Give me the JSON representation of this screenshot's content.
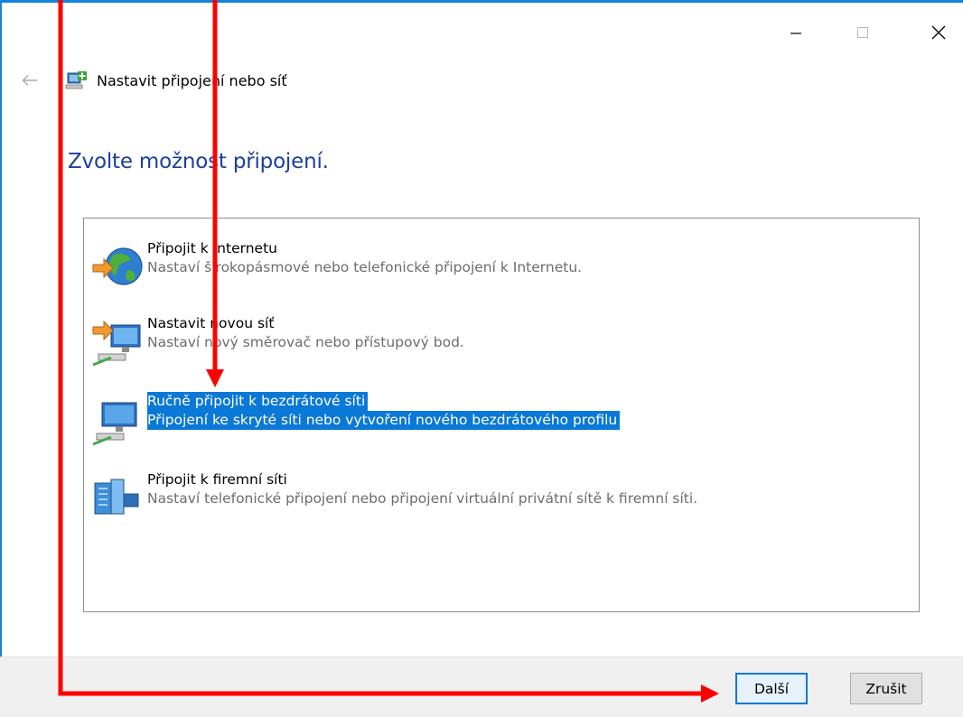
{
  "window": {
    "controls": {
      "minimize_icon": "minimize-icon",
      "maximize_icon": "maximize-icon",
      "close_icon": "close-icon"
    }
  },
  "nav": {
    "back_icon": "back-arrow-icon",
    "wizard_icon": "network-setup-icon",
    "title": "Nastavit připojení nebo síť"
  },
  "heading": "Zvolte možnost připojení.",
  "options": [
    {
      "title": "Připojit k Internetu",
      "description": "Nastaví širokopásmové nebo telefonické připojení k Internetu.",
      "icon": "internet-globe-icon",
      "selected": false
    },
    {
      "title": "Nastavit novou síť",
      "description": "Nastaví nový směrovač nebo přístupový bod.",
      "icon": "new-network-icon",
      "selected": false
    },
    {
      "title": "Ručně připojit k bezdrátové síti",
      "description": "Připojení ke skryté síti nebo vytvoření nového bezdrátového profilu",
      "icon": "wireless-network-icon",
      "selected": true
    },
    {
      "title": "Připojit k firemní síti",
      "description": "Nastaví telefonické připojení nebo připojení virtuální privátní sítě k firemní síti.",
      "icon": "workplace-network-icon",
      "selected": false
    }
  ],
  "buttons": {
    "next": "Další",
    "cancel": "Zrušit"
  },
  "annotation": {
    "arrow_color": "#ff0000",
    "selection_color": "#0a78d7",
    "heading_color": "#1b3f9c"
  }
}
